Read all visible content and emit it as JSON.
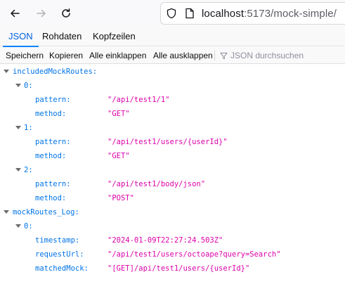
{
  "browser": {
    "url_host": "localhost",
    "url_path": ":5173/mock-simple/",
    "icons": {
      "back": "arrow-left-icon",
      "forward": "arrow-right-icon",
      "reload": "reload-icon",
      "shield": "shield-icon",
      "page": "page-icon"
    }
  },
  "viewer_tabs": [
    {
      "label": "JSON",
      "active": true
    },
    {
      "label": "Rohdaten",
      "active": false
    },
    {
      "label": "Kopfzeilen",
      "active": false
    }
  ],
  "json_toolbar": {
    "save": "Speichern",
    "copy": "Kopieren",
    "collapse_all": "Alle einklappen",
    "expand_all": "Alle ausklappen",
    "filter_placeholder": "JSON durchsuchen"
  },
  "tree": {
    "included_key": "includedMockRoutes:",
    "included": [
      {
        "index": "0:",
        "pattern_key": "pattern:",
        "pattern": "\"/api/test1/1\"",
        "method_key": "method:",
        "method": "\"GET\""
      },
      {
        "index": "1:",
        "pattern_key": "pattern:",
        "pattern": "\"/api/test1/users/{userId}\"",
        "method_key": "method:",
        "method": "\"GET\""
      },
      {
        "index": "2:",
        "pattern_key": "pattern:",
        "pattern": "\"/api/test1/body/json\"",
        "method_key": "method:",
        "method": "\"POST\""
      }
    ],
    "log_key": "mockRoutes_Log:",
    "log": [
      {
        "index": "0:",
        "timestamp_key": "timestamp:",
        "timestamp": "\"2024-01-09T22:27:24.503Z\"",
        "requestUrl_key": "requestUrl:",
        "requestUrl": "\"/api/test1/users/octoape?query=Search\"",
        "matchedMock_key": "matchedMock:",
        "matchedMock": "\"[GET]/api/test1/users/{userId}\""
      }
    ]
  },
  "colors": {
    "key": "#0074e8",
    "string": "#dd00a9",
    "active_tab": "#0060df"
  }
}
